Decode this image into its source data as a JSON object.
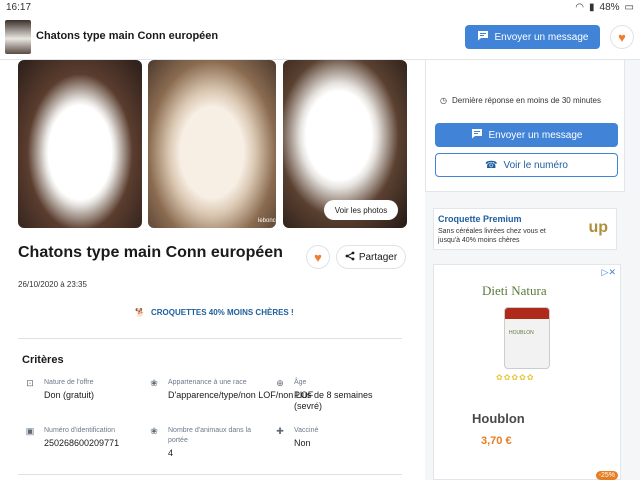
{
  "status_bar": {
    "time": "16:17",
    "battery": "48%"
  },
  "header": {
    "title": "Chatons type main Conn européen",
    "message_button": "Envoyer un message"
  },
  "gallery": {
    "watermark": "leboncoin",
    "see_photos_button": "Voir les photos"
  },
  "listing": {
    "title": "Chatons type main Conn européen",
    "share_button": "Partager",
    "date": "26/10/2020 à 23:35",
    "promo_text": "CROQUETTES 40% MOINS CHÈRES !"
  },
  "criteria": {
    "title": "Critères",
    "items": [
      {
        "label": "Nature de l'offre",
        "value": "Don (gratuit)",
        "icon": "offer-icon"
      },
      {
        "label": "Appartenance à une race",
        "value": "D'apparence/type/non LOF/non LOF",
        "icon": "paw-icon"
      },
      {
        "label": "Âge",
        "value": "Plus de 8 semaines (sevré)",
        "icon": "age-icon"
      },
      {
        "label": "Numéro d'identification",
        "value": "250268600209771",
        "icon": "id-icon"
      },
      {
        "label": "Nombre d'animaux dans la portée",
        "value": "4",
        "icon": "litter-icon"
      },
      {
        "label": "Vacciné",
        "value": "Non",
        "icon": "vaccine-icon"
      }
    ]
  },
  "seller_card": {
    "response_time": "Dernière réponse en moins de 30 minutes",
    "message_button": "Envoyer un message",
    "phone_button": "Voir le numéro"
  },
  "sponsored": {
    "title": "Croquette Premium",
    "description": "Sans céréales livrées chez vous et jusqu'à 40% moins chères",
    "logo": "up"
  },
  "ad": {
    "brand": "Dieti Natura",
    "bottle_label": "HOUBLON",
    "product": "Houblon",
    "price": "3,70 €",
    "discount": "-25%"
  },
  "colors": {
    "primary": "#4183d7",
    "accent": "#ed7d31",
    "link": "#1d5e9e"
  }
}
